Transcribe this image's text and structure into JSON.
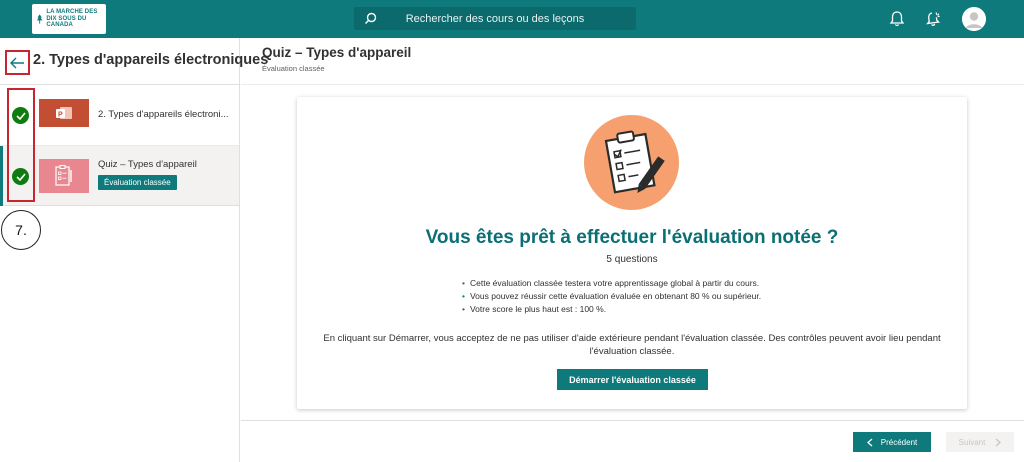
{
  "colors": {
    "brand": "#0f7a7c",
    "success": "#107c10",
    "annotation": "#c8262e"
  },
  "header": {
    "logo_text": "LA MARCHE DES DIX SOUS DU CANADA",
    "search_placeholder": "Rechercher des cours ou des leçons",
    "icons": [
      "search-icon",
      "bell-icon",
      "notification-bell-icon",
      "avatar-icon"
    ]
  },
  "sidebar": {
    "title": "2. Types d'appareils électroniques",
    "items": [
      {
        "label": "2. Types d'appareils électroni...",
        "status": "completed",
        "icon": "powerpoint-icon"
      },
      {
        "label": "Quiz – Types d'appareil",
        "badge": "Évaluation classée",
        "status": "completed",
        "icon": "quiz-icon"
      }
    ]
  },
  "annotation": {
    "step_label": "7."
  },
  "main": {
    "title": "Quiz – Types d'appareil",
    "subtitle": "Évaluation classée",
    "card": {
      "heading": "Vous êtes prêt à effectuer l'évaluation notée ?",
      "question_count": "5 questions",
      "bullets": [
        "Cette évaluation classée testera votre apprentissage global à partir du cours.",
        "Vous pouvez réussir cette évaluation évaluée en obtenant 80 % ou supérieur.",
        "Votre score le plus haut est : 100 %."
      ],
      "disclaimer": "En cliquant sur Démarrer, vous acceptez de ne pas utiliser d'aide extérieure pendant l'évaluation classée. Des contrôles peuvent avoir lieu pendant l'évaluation classée.",
      "start_button": "Démarrer l'évaluation classée"
    }
  },
  "footer": {
    "previous_label": "Précédent",
    "next_label": "Suivant"
  }
}
